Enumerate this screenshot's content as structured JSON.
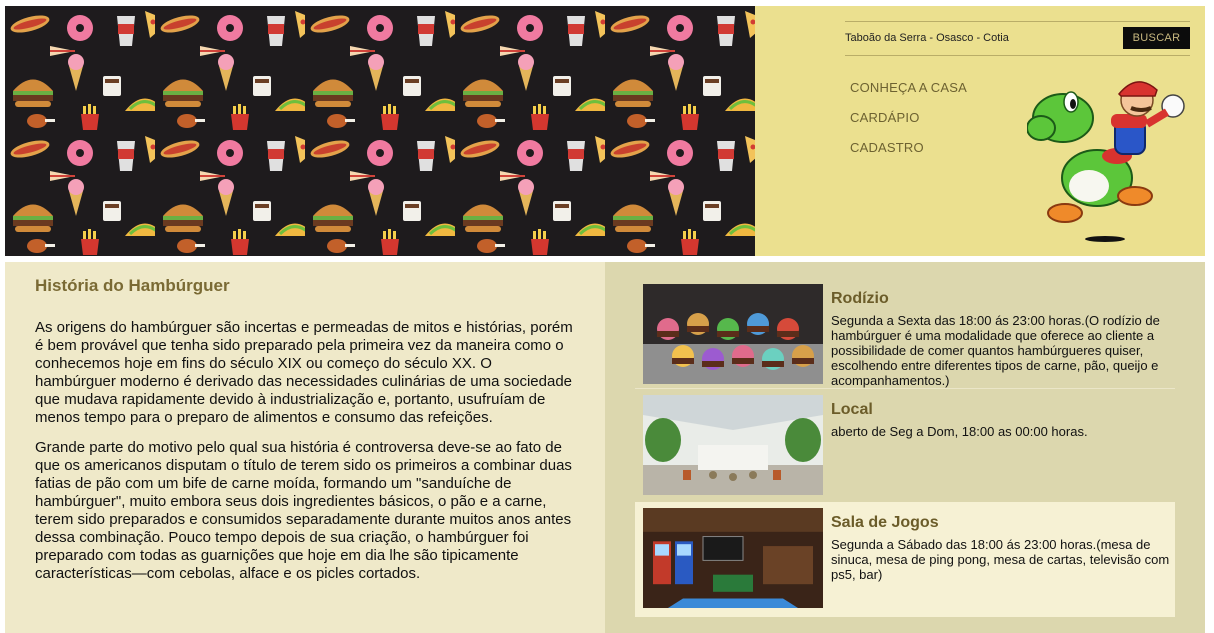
{
  "header": {
    "cities": "Taboão da Serra - Osasco - Cotia",
    "search_label": "BUSCAR",
    "nav": [
      "CONHEÇA A CASA",
      "CARDÁPIO",
      "CADASTRO"
    ]
  },
  "history": {
    "title": "História do Hambúrguer",
    "paragraphs": [
      "As origens do hambúrguer são incertas e permeadas de mitos e histórias, porém é bem provável que tenha sido preparado pela primeira vez da maneira como o conhecemos hoje em fins do século XIX ou começo do século XX. O hambúrguer moderno é derivado das necessidades culinárias de uma sociedade que mudava rapidamente devido à industrialização e, portanto, usufruíam de menos tempo para o preparo de alimentos e consumo das refeições.",
      "Grande parte do motivo pelo qual sua história é controversa deve-se ao fato de que os americanos disputam o título de terem sido os primeiros a combinar duas fatias de pão com um bife de carne moída, formando um \"sanduíche de hambúrguer\", muito embora seus dois ingredientes básicos, o pão e a carne, terem sido preparados e consumidos separadamente durante muitos anos antes dessa combinação. Pouco tempo depois de sua criação, o hambúrguer foi preparado com todas as guarnições que hoje em dia lhe são tipicamente características—com cebolas, alface e os picles cortados."
    ]
  },
  "cards": [
    {
      "title": "Rodízio",
      "text": "Segunda a Sexta das 18:00 ás 23:00 horas.(O rodízio de hambúrguer é uma modalidade que oferece ao cliente a possibilidade de comer quantos hambúrgueres quiser, escolhendo entre diferentes tipos de carne, pão, queijo e acompanhamentos.)"
    },
    {
      "title": "Local",
      "text": "aberto de Seg a Dom, 18:00 as 00:00 horas."
    },
    {
      "title": "Sala de Jogos",
      "text": "Segunda a Sábado das 18:00 ás 23:00 horas.(mesa de sinuca, mesa de ping pong, mesa de cartas, televisão com ps5, bar)"
    }
  ],
  "colors": {
    "header_bg": "#ebe08f",
    "content_bg": "#dcd7ae",
    "history_bg": "#efe9c9",
    "title_color": "#7a6a34",
    "button_bg": "#0c0c0c"
  },
  "icons": {
    "banner": "junk-food-pattern",
    "mascot": "mario-riding-yoshi"
  }
}
